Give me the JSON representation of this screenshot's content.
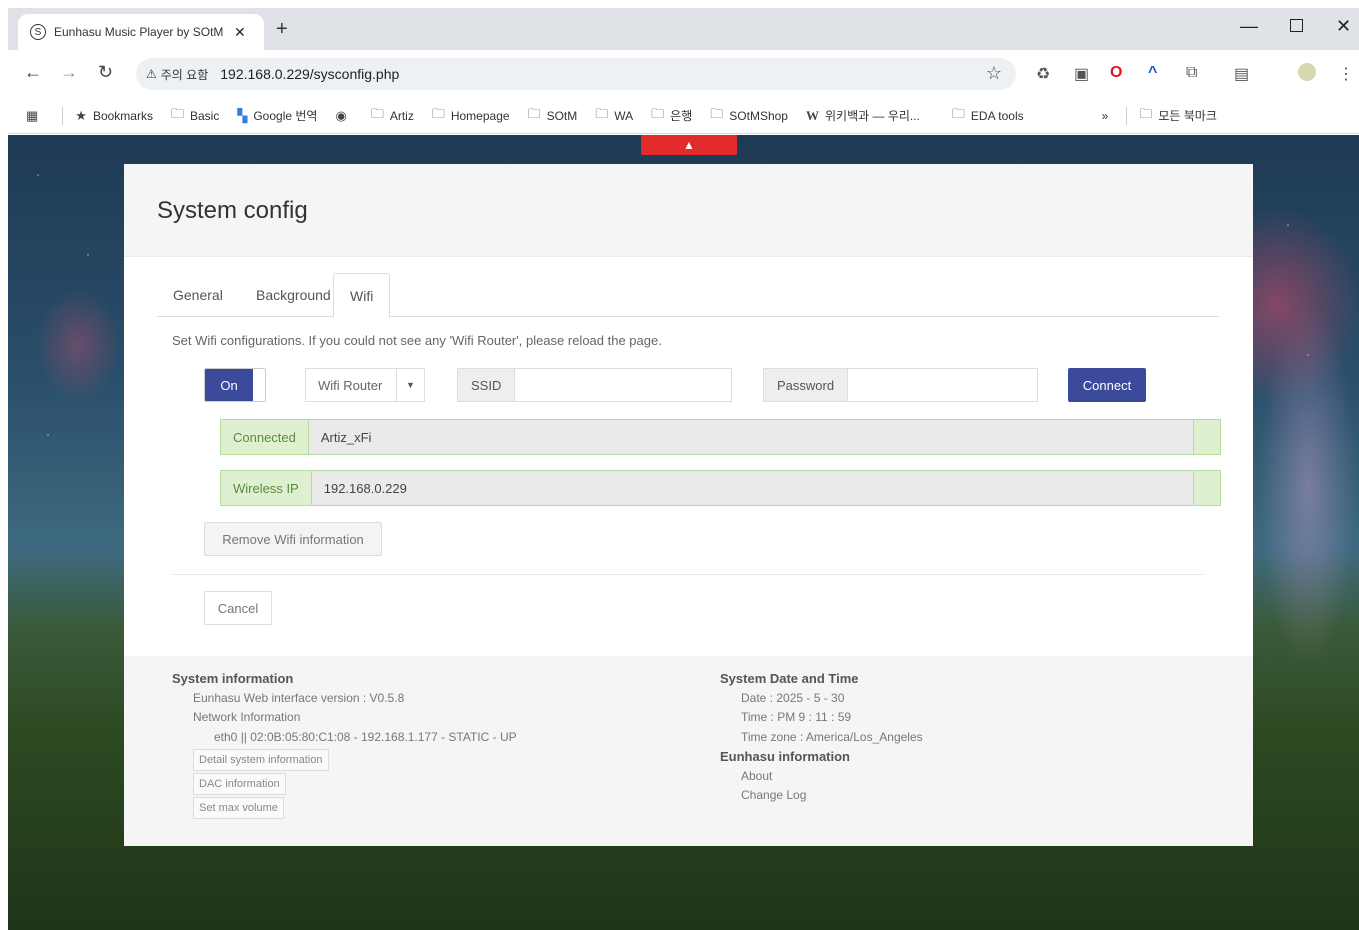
{
  "browser": {
    "tab_title": "Eunhasu Music Player by SOtM",
    "tab_close": "✕",
    "new_tab": "+",
    "security_label": "주의 요함",
    "url": "192.168.0.229/sysconfig.php",
    "bookmarks": [
      {
        "label": "Bookmarks",
        "icon": "★"
      },
      {
        "label": "Basic",
        "icon": "folder"
      },
      {
        "label": "Google 번역",
        "icon": "translate"
      },
      {
        "label": "",
        "icon": "globe"
      },
      {
        "label": "Artiz",
        "icon": "folder"
      },
      {
        "label": "Homepage",
        "icon": "folder"
      },
      {
        "label": "SOtM",
        "icon": "folder"
      },
      {
        "label": "WA",
        "icon": "folder"
      },
      {
        "label": "은행",
        "icon": "folder"
      },
      {
        "label": "SOtMShop",
        "icon": "folder"
      },
      {
        "label": "위키백과 — 우리...",
        "icon": "W"
      },
      {
        "label": "EDA tools",
        "icon": "folder"
      }
    ],
    "more_bookmarks": "»",
    "all_bookmarks": "모든 북마크"
  },
  "panel": {
    "title": "System config",
    "tabs": [
      {
        "label": "General"
      },
      {
        "label": "Background"
      },
      {
        "label": "Wifi"
      }
    ],
    "hint": "Set Wifi configurations. If you could not see any 'Wifi Router', please reload the page.",
    "on_label": "On",
    "router_select": "Wifi Router",
    "ssid_label": "SSID",
    "ssid_value": "",
    "password_label": "Password",
    "password_value": "",
    "connect_label": "Connect",
    "connected_label": "Connected",
    "connected_value": "Artiz_xFi",
    "ip_label": "Wireless IP",
    "ip_value": "192.168.0.229",
    "remove_label": "Remove Wifi information",
    "cancel_label": "Cancel"
  },
  "footer": {
    "sysinfo_heading": "System information",
    "version": "Eunhasu Web interface version : V0.5.8",
    "network_heading": "Network Information",
    "network_line": "eth0 || 02:0B:05:80:C1:08 - 192.168.1.177 - STATIC - UP",
    "detail_btn": "Detail system information",
    "dac_btn": "DAC information",
    "maxvol_btn": "Set max volume",
    "datetime_heading": "System Date and Time",
    "date": "Date : 2025 - 5 - 30",
    "time": "Time : PM 9 : 11 : 59",
    "timezone": "Time zone : America/Los_Angeles",
    "eunhasu_heading": "Eunhasu information",
    "about": "About",
    "changelog": "Change Log"
  }
}
